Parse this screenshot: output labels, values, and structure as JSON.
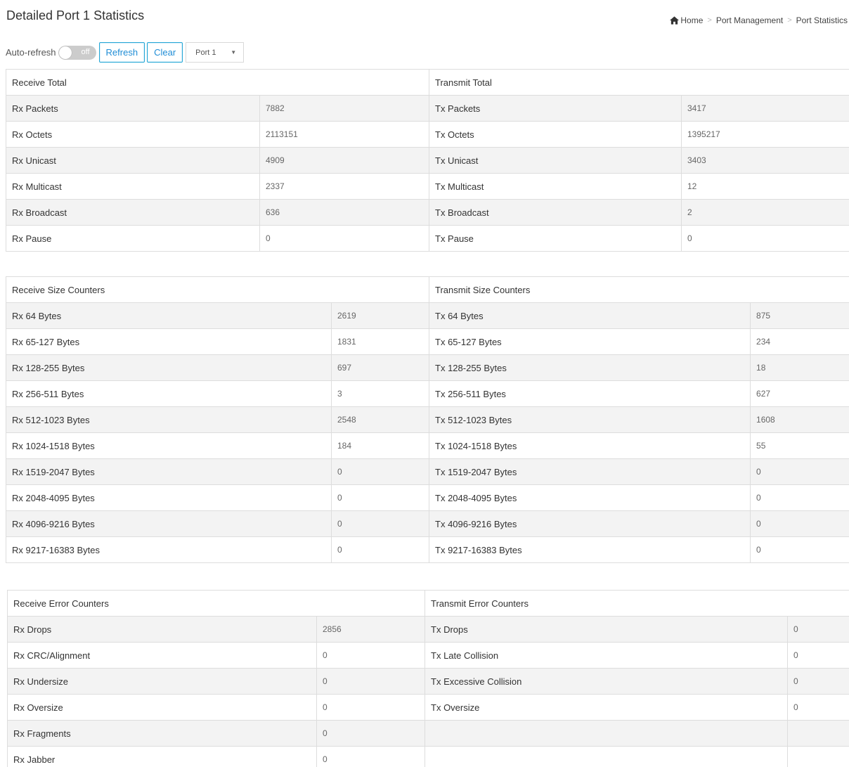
{
  "page_title": "Detailed Port 1 Statistics",
  "breadcrumb": [
    "Home",
    "Port Management",
    "Port Statistics"
  ],
  "toolbar": {
    "auto_refresh_label": "Auto-refresh",
    "toggle_state": "off",
    "refresh_label": "Refresh",
    "clear_label": "Clear",
    "port_select": "Port 1"
  },
  "colors": {
    "accent": "#23a6d5",
    "toggle_off": "#cccccc",
    "row_stripe": "#f3f3f3"
  },
  "totals": {
    "rx_header": "Receive Total",
    "tx_header": "Transmit Total",
    "rows": [
      {
        "rx_label": "Rx Packets",
        "rx_value": "7882",
        "tx_label": "Tx Packets",
        "tx_value": "3417"
      },
      {
        "rx_label": "Rx Octets",
        "rx_value": "2113151",
        "tx_label": "Tx Octets",
        "tx_value": "1395217"
      },
      {
        "rx_label": "Rx Unicast",
        "rx_value": "4909",
        "tx_label": "Tx Unicast",
        "tx_value": "3403"
      },
      {
        "rx_label": "Rx Multicast",
        "rx_value": "2337",
        "tx_label": "Tx Multicast",
        "tx_value": "12"
      },
      {
        "rx_label": "Rx Broadcast",
        "rx_value": "636",
        "tx_label": "Tx Broadcast",
        "tx_value": "2"
      },
      {
        "rx_label": "Rx Pause",
        "rx_value": "0",
        "tx_label": "Tx Pause",
        "tx_value": "0"
      }
    ]
  },
  "sizes": {
    "rx_header": "Receive Size Counters",
    "tx_header": "Transmit Size Counters",
    "rows": [
      {
        "rx_label": "Rx 64 Bytes",
        "rx_value": "2619",
        "tx_label": "Tx 64 Bytes",
        "tx_value": "875"
      },
      {
        "rx_label": "Rx 65-127 Bytes",
        "rx_value": "1831",
        "tx_label": "Tx 65-127 Bytes",
        "tx_value": "234"
      },
      {
        "rx_label": "Rx 128-255 Bytes",
        "rx_value": "697",
        "tx_label": "Tx 128-255 Bytes",
        "tx_value": "18"
      },
      {
        "rx_label": "Rx 256-511 Bytes",
        "rx_value": "3",
        "tx_label": "Tx 256-511 Bytes",
        "tx_value": "627"
      },
      {
        "rx_label": "Rx 512-1023 Bytes",
        "rx_value": "2548",
        "tx_label": "Tx 512-1023 Bytes",
        "tx_value": "1608"
      },
      {
        "rx_label": "Rx 1024-1518 Bytes",
        "rx_value": "184",
        "tx_label": "Tx 1024-1518 Bytes",
        "tx_value": "55"
      },
      {
        "rx_label": "Rx 1519-2047 Bytes",
        "rx_value": "0",
        "tx_label": "Tx 1519-2047 Bytes",
        "tx_value": "0"
      },
      {
        "rx_label": "Rx 2048-4095 Bytes",
        "rx_value": "0",
        "tx_label": "Tx 2048-4095 Bytes",
        "tx_value": "0"
      },
      {
        "rx_label": "Rx 4096-9216 Bytes",
        "rx_value": "0",
        "tx_label": "Tx 4096-9216 Bytes",
        "tx_value": "0"
      },
      {
        "rx_label": "Rx 9217-16383 Bytes",
        "rx_value": "0",
        "tx_label": "Tx 9217-16383 Bytes",
        "tx_value": "0"
      }
    ]
  },
  "errors": {
    "rx_header": "Receive Error Counters",
    "tx_header": "Transmit Error Counters",
    "rows": [
      {
        "rx_label": "Rx Drops",
        "rx_value": "2856",
        "tx_label": "Tx Drops",
        "tx_value": "0"
      },
      {
        "rx_label": "Rx CRC/Alignment",
        "rx_value": "0",
        "tx_label": "Tx Late Collision",
        "tx_value": "0"
      },
      {
        "rx_label": "Rx Undersize",
        "rx_value": "0",
        "tx_label": "Tx Excessive Collision",
        "tx_value": "0"
      },
      {
        "rx_label": "Rx Oversize",
        "rx_value": "0",
        "tx_label": "Tx Oversize",
        "tx_value": "0"
      },
      {
        "rx_label": "Rx Fragments",
        "rx_value": "0",
        "tx_label": "",
        "tx_value": ""
      },
      {
        "rx_label": "Rx Jabber",
        "rx_value": "0",
        "tx_label": "",
        "tx_value": ""
      }
    ]
  }
}
